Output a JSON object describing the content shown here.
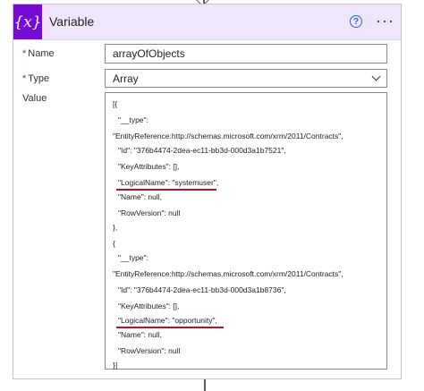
{
  "header": {
    "title": "Variable",
    "icon_text": "{x}"
  },
  "fields": {
    "name_label": "Name",
    "name_value": "arrayOfObjects",
    "type_label": "Type",
    "type_value": "Array",
    "value_label": "Value"
  },
  "value_lines": [
    "[{",
    "\"__type\":",
    "\"EntityReference:http://schemas.microsoft.com/xrm/2011/Contracts\",",
    "\"Id\": \"376b4474-2dea-ec11-bb3d-000d3a1b7521\",",
    "\"KeyAttributes\": [],",
    "\"LogicalName\": \"systemuser\",",
    "\"Name\": null,",
    "\"RowVersion\": null",
    "},",
    "{",
    "\"__type\":",
    "\"EntityReference:http://schemas.microsoft.com/xrm/2011/Contracts\",",
    "\"Id\": \"376b4474-2dea-ec11-bb3d-000d3a1b8736\",",
    "\"KeyAttributes\": [],",
    "\"LogicalName\": \"opportunity\",",
    "\"Name\": null,",
    "\"RowVersion\": null",
    "}]"
  ],
  "colors": {
    "accent": "#770bd6",
    "header_bg": "#f0e6fb",
    "highlight": "#c50f1f",
    "help": "#2266e3"
  },
  "icons": {
    "help": "help-circle-icon",
    "more": "more-options-icon",
    "dropdown": "chevron-down-icon"
  }
}
